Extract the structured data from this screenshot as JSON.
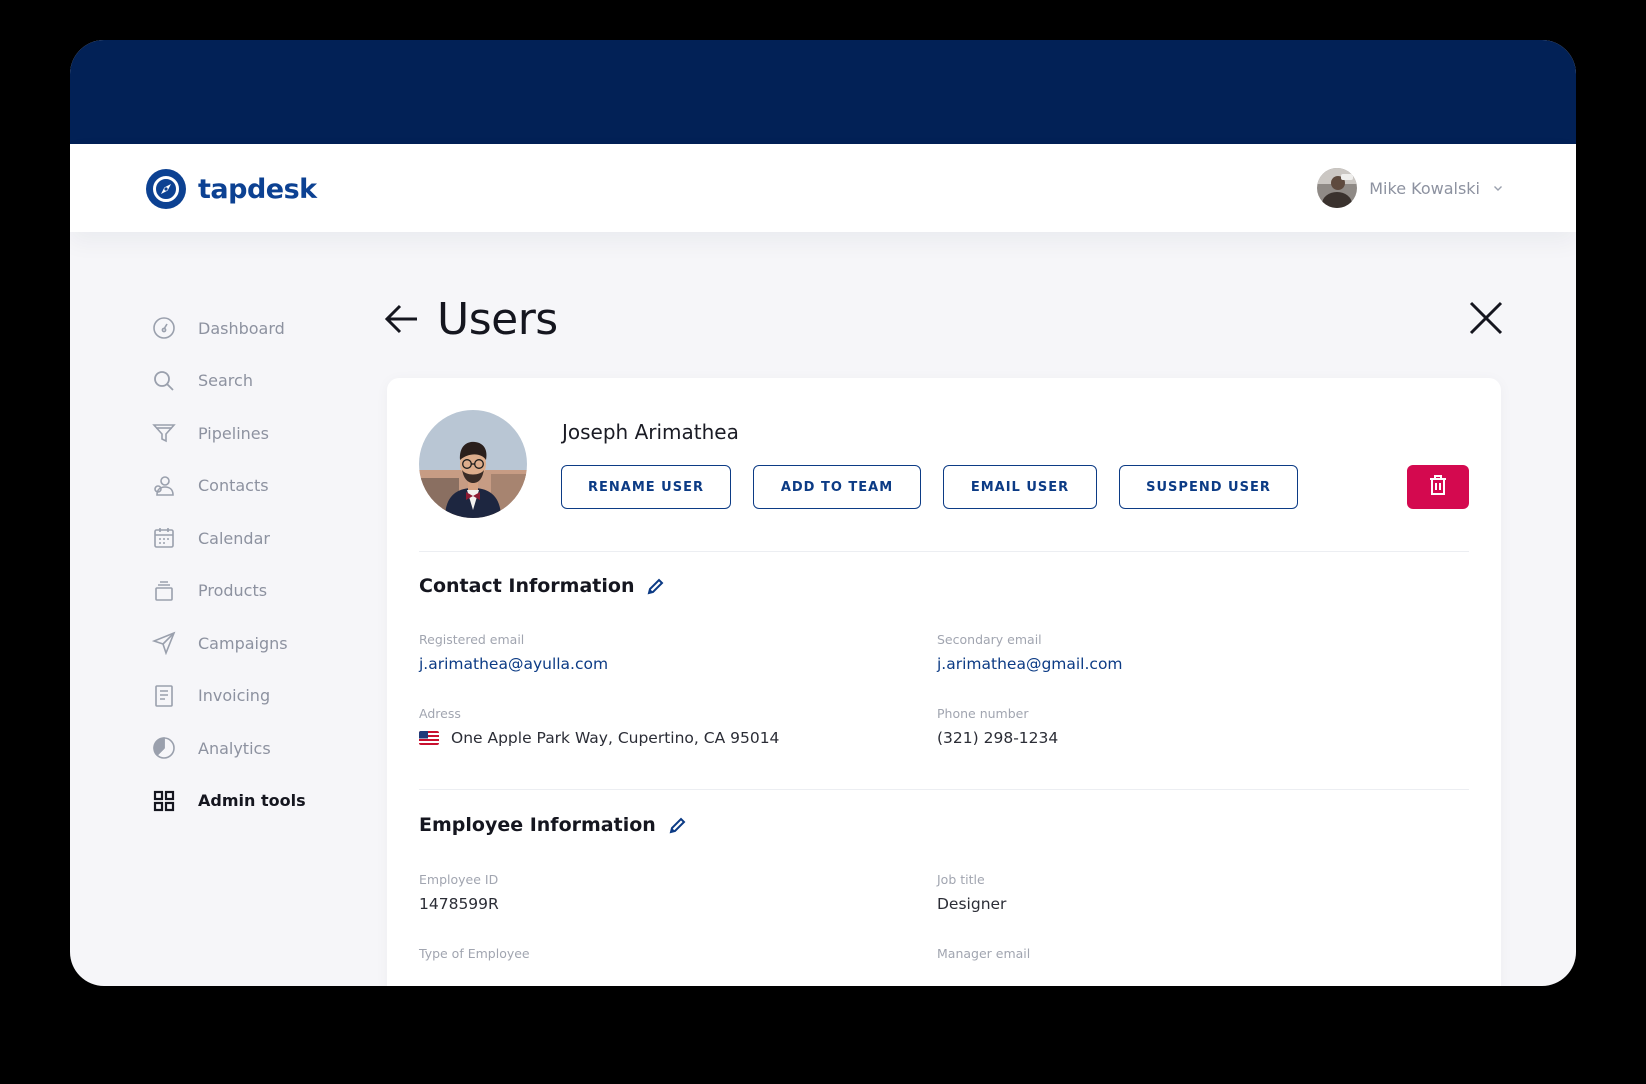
{
  "app": {
    "logo_text": "tapdesk"
  },
  "header": {
    "user_name": "Mike Kowalski"
  },
  "sidebar": {
    "items": [
      {
        "label": "Dashboard",
        "icon": "dashboard-icon"
      },
      {
        "label": "Search",
        "icon": "search-icon"
      },
      {
        "label": "Pipelines",
        "icon": "funnel-icon"
      },
      {
        "label": "Contacts",
        "icon": "contacts-icon"
      },
      {
        "label": "Calendar",
        "icon": "calendar-icon"
      },
      {
        "label": "Products",
        "icon": "products-icon"
      },
      {
        "label": "Campaigns",
        "icon": "paper-plane-icon"
      },
      {
        "label": "Invoicing",
        "icon": "invoice-icon"
      },
      {
        "label": "Analytics",
        "icon": "pie-chart-icon"
      },
      {
        "label": "Admin tools",
        "icon": "grid-icon",
        "active": true
      }
    ]
  },
  "page": {
    "title": "Users"
  },
  "profile": {
    "name": "Joseph Arimathea",
    "actions": {
      "rename": "RENAME USER",
      "add_to_team": "ADD TO TEAM",
      "email": "EMAIL USER",
      "suspend": "SUSPEND USER"
    }
  },
  "contact": {
    "title": "Contact Information",
    "registered_email_label": "Registered email",
    "registered_email": "j.arimathea@ayulla.com",
    "secondary_email_label": "Secondary email",
    "secondary_email": "j.arimathea@gmail.com",
    "address_label": "Adress",
    "address": "One Apple Park Way, Cupertino, CA 95014",
    "phone_label": "Phone number",
    "phone": "(321) 298-1234"
  },
  "employee": {
    "title": "Employee Information",
    "id_label": "Employee ID",
    "id": "1478599R",
    "job_title_label": "Job title",
    "job_title": "Designer",
    "type_label": "Type of Employee",
    "manager_email_label": "Manager email"
  },
  "colors": {
    "top_band": "#022156",
    "brand": "#0c4192",
    "button_outline": "#0c3b85",
    "danger": "#d4094f",
    "background": "#f6f6f9"
  }
}
